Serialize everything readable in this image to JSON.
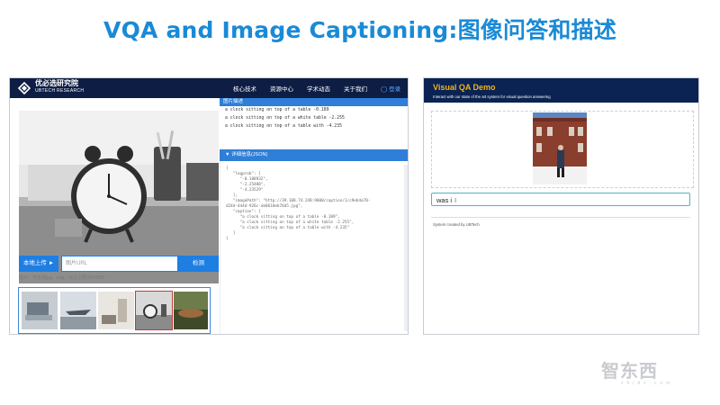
{
  "slide": {
    "title": "VQA and Image Captioning:图像问答和描述"
  },
  "left_app": {
    "brand_cn": "优必选研究院",
    "brand_en": "UBTECH RESEARCH",
    "nav": [
      "核心技术",
      "资源中心",
      "学术动态",
      "关于我们"
    ],
    "login": "登录",
    "upload_button": "本地上传",
    "url_placeholder": "图片URL",
    "search_button": "检测",
    "hint": "提示：可支持jpg，png，大小上限为512KB",
    "caption_header": "图片描述",
    "captions": [
      "a clock sitting on top of a table -0.189",
      "a clock sitting on top of a white table -2.255",
      "a clock sitting on top of a table with -4.235"
    ],
    "json_header": "▼  详细信息(JSON)",
    "json_lines": [
      "{",
      "   \"logprob\": [",
      "      \"-0.188932\",",
      "      \"-2.25488\",",
      "      \"-4.23529\"",
      "   ],",
      "   \"imagePath\": \"http://39.108.74.248:9000/caption/1/c9eb4a70-",
      "d24d-444d-926c-ab8610eb76d5.jpg\",",
      "   \"caption\": [",
      "      \"a clock sitting on top of a table -0.189\",",
      "      \"a clock sitting on top of a white table -2.255\",",
      "      \"a clock sitting on top of a table with -4.235\"",
      "   ]",
      "}"
    ]
  },
  "right_app": {
    "title": "Visual QA Demo",
    "subtitle": "Interact with our state of the art system for visual question answering",
    "question_value": "was i",
    "credit": "System created by UBTech"
  },
  "watermark": {
    "main": "智东西",
    "sub": "zhidx.com"
  },
  "colors": {
    "title": "#1a8ad6",
    "nav_bg": "#0d1d44",
    "accent": "#1e7ee2",
    "vqa_banner": "#0a2352",
    "vqa_title": "#f2b31b"
  }
}
